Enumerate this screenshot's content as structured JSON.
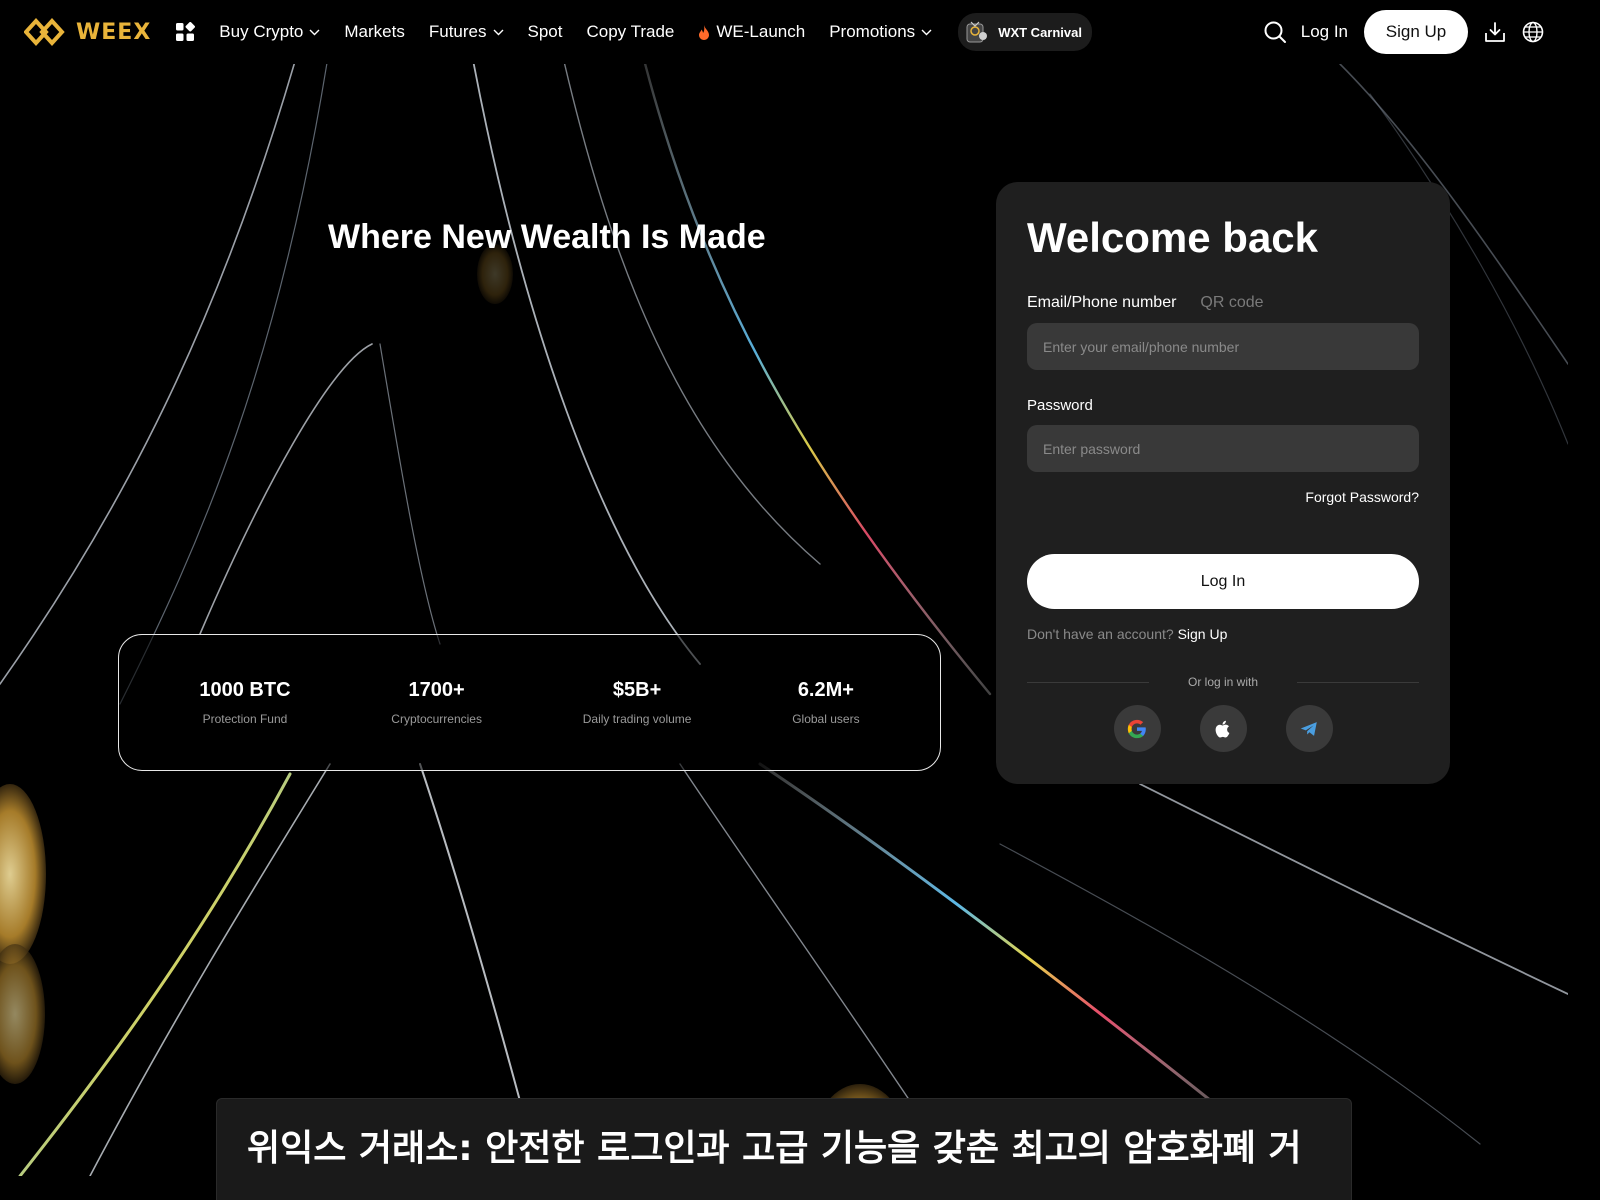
{
  "nav": {
    "brand": "WEEX",
    "items": [
      {
        "label": "Buy Crypto",
        "dropdown": true
      },
      {
        "label": "Markets",
        "dropdown": false
      },
      {
        "label": "Futures",
        "dropdown": true
      },
      {
        "label": "Spot",
        "dropdown": false
      },
      {
        "label": "Copy Trade",
        "dropdown": false
      },
      {
        "label": "WE-Launch",
        "dropdown": false,
        "icon": "flame-icon"
      },
      {
        "label": "Promotions",
        "dropdown": true
      }
    ],
    "carnival_label": "WXT Carnival",
    "login_label": "Log In",
    "signup_label": "Sign Up"
  },
  "hero": {
    "headline": "Where New Wealth Is Made",
    "stats": [
      {
        "value": "1000 BTC",
        "label": "Protection Fund"
      },
      {
        "value": "1700+",
        "label": "Cryptocurrencies"
      },
      {
        "value": "$5B+",
        "label": "Daily trading volume"
      },
      {
        "value": "6.2M+",
        "label": "Global users"
      }
    ]
  },
  "login_card": {
    "title": "Welcome back",
    "tabs": [
      {
        "label": "Email/Phone number",
        "active": true
      },
      {
        "label": "QR code",
        "active": false
      }
    ],
    "email_placeholder": "Enter your email/phone number",
    "password_label": "Password",
    "password_placeholder": "Enter password",
    "forgot_label": "Forgot Password?",
    "login_button": "Log In",
    "no_account_text": "Don't have an account?",
    "signup_link": "Sign Up",
    "or_login_with": "Or log in with",
    "social_providers": [
      "google-icon",
      "apple-icon",
      "telegram-icon"
    ]
  },
  "article": {
    "title": "위익스 거래소: 안전한 로그인과 고급 기능을 갖춘 최고의 암호화폐 거"
  },
  "colors": {
    "brand": "#e9b43a",
    "card_bg": "#1f1f1f",
    "input_bg": "#393939",
    "page_bg": "#000000"
  }
}
